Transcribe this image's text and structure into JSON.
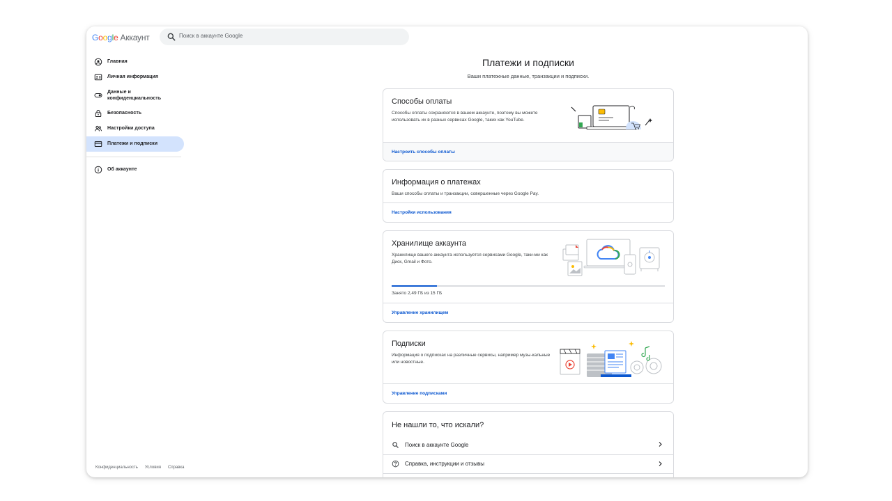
{
  "header": {
    "logo_letters": [
      "G",
      "o",
      "o",
      "g",
      "l",
      "e"
    ],
    "logo_product": "Аккаунт",
    "search_placeholder": "Поиск в аккаунте Google"
  },
  "sidebar": {
    "items": [
      {
        "label": "Главная",
        "icon": "home-person-icon"
      },
      {
        "label": "Личная информация",
        "icon": "id-card-icon"
      },
      {
        "label_line1": "Данные и",
        "label_line2": "конфиденциальность",
        "icon": "toggle-icon"
      },
      {
        "label": "Безопасность",
        "icon": "lock-icon"
      },
      {
        "label": "Настройки доступа",
        "icon": "people-icon"
      },
      {
        "label": "Платежи и подписки",
        "icon": "credit-card-icon",
        "active": true
      },
      {
        "label": "Об аккаунте",
        "icon": "info-icon"
      }
    ],
    "footer": [
      "Конфиденциальность",
      "Условия",
      "Справка"
    ]
  },
  "main": {
    "title": "Платежи и подписки",
    "subtitle": "Ваши платежные данные, транзакции и подписки.",
    "payment_methods": {
      "title": "Способы оплаты",
      "desc": "Способы оплаты сохраняются в вашем аккаунте, поэтому вы можете использовать их в разных сервисах Google, таких как YouTube.",
      "link": "Настроить способы оплаты"
    },
    "payments_info": {
      "title": "Информация о платежах",
      "desc": "Ваши способы оплаты и транзакции, совершенные через Google Pay.",
      "link": "Настройки использования"
    },
    "storage": {
      "title": "Хранилище аккаунта",
      "desc": "Хранилище вашего аккаунта используется сервисами Google, таки-ми как Диск, Gmail и Фото.",
      "usage_text": "Занято 2,49 ГБ из 15 ГБ",
      "used_fraction": 0.166,
      "link": "Управление хранилищем"
    },
    "subscriptions": {
      "title": "Подписки",
      "desc": "Информация о подписках на различные сервисы, например музы-кальные или новостные.",
      "link": "Управление подписками"
    },
    "help": {
      "title": "Не нашли то, что искали?",
      "rows": [
        {
          "label": "Поиск в аккаунте Google",
          "icon": "search-icon"
        },
        {
          "label": "Справка, инструкции и отзывы",
          "icon": "help-circle-icon"
        }
      ]
    }
  },
  "colors": {
    "accent": "#0b57d0",
    "active_nav": "#d3e3fd",
    "border": "#dadce0"
  }
}
